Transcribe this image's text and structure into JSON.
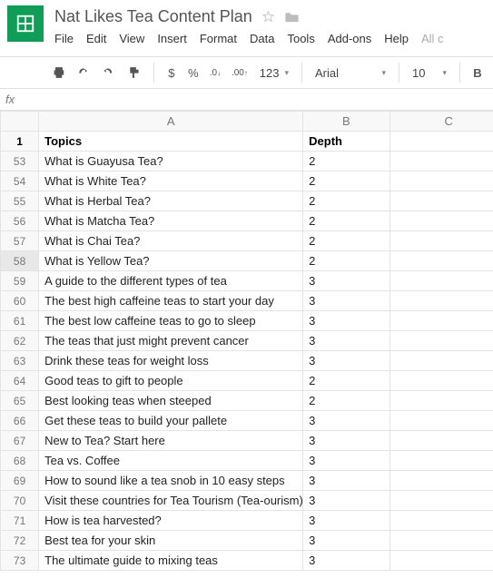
{
  "doc": {
    "title": "Nat Likes Tea Content Plan"
  },
  "menu": {
    "file": "File",
    "edit": "Edit",
    "view": "View",
    "insert": "Insert",
    "format": "Format",
    "data": "Data",
    "tools": "Tools",
    "addons": "Add-ons",
    "help": "Help",
    "all_changes": "All c"
  },
  "toolbar": {
    "dollar": "$",
    "percent": "%",
    "dec_dec": ".0",
    "dec_inc": ".00",
    "num_format": "123",
    "font": "Arial",
    "font_size": "10",
    "bold": "B"
  },
  "fx": {
    "label": "fx",
    "value": ""
  },
  "columns": {
    "A": "A",
    "B": "B",
    "C": "C"
  },
  "headers": {
    "topics": "Topics",
    "depth": "Depth"
  },
  "selected_row": 58,
  "rows": [
    {
      "n": 53,
      "topic": "What is Guayusa Tea?",
      "depth": 2
    },
    {
      "n": 54,
      "topic": "What is White Tea?",
      "depth": 2
    },
    {
      "n": 55,
      "topic": "What is Herbal Tea?",
      "depth": 2
    },
    {
      "n": 56,
      "topic": "What is Matcha Tea?",
      "depth": 2
    },
    {
      "n": 57,
      "topic": "What is Chai Tea?",
      "depth": 2
    },
    {
      "n": 58,
      "topic": "What is Yellow Tea?",
      "depth": 2
    },
    {
      "n": 59,
      "topic": "A guide to the different types of tea",
      "depth": 3
    },
    {
      "n": 60,
      "topic": "The best high caffeine teas to start your day",
      "depth": 3
    },
    {
      "n": 61,
      "topic": "The best low caffeine teas to go to sleep",
      "depth": 3
    },
    {
      "n": 62,
      "topic": "The teas that just might prevent cancer",
      "depth": 3
    },
    {
      "n": 63,
      "topic": "Drink these teas for weight loss",
      "depth": 3
    },
    {
      "n": 64,
      "topic": "Good teas to gift to people",
      "depth": 2
    },
    {
      "n": 65,
      "topic": "Best looking teas when steeped",
      "depth": 2
    },
    {
      "n": 66,
      "topic": "Get these teas to build your pallete",
      "depth": 3
    },
    {
      "n": 67,
      "topic": "New to Tea? Start here",
      "depth": 3
    },
    {
      "n": 68,
      "topic": "Tea vs. Coffee",
      "depth": 3
    },
    {
      "n": 69,
      "topic": "How to sound like a tea snob in 10 easy steps",
      "depth": 3
    },
    {
      "n": 70,
      "topic": "Visit these countries for Tea Tourism (Tea-ourism)",
      "depth": 3
    },
    {
      "n": 71,
      "topic": "How is tea harvested?",
      "depth": 3
    },
    {
      "n": 72,
      "topic": "Best tea for your skin",
      "depth": 3
    },
    {
      "n": 73,
      "topic": "The ultimate guide to mixing teas",
      "depth": 3
    }
  ]
}
